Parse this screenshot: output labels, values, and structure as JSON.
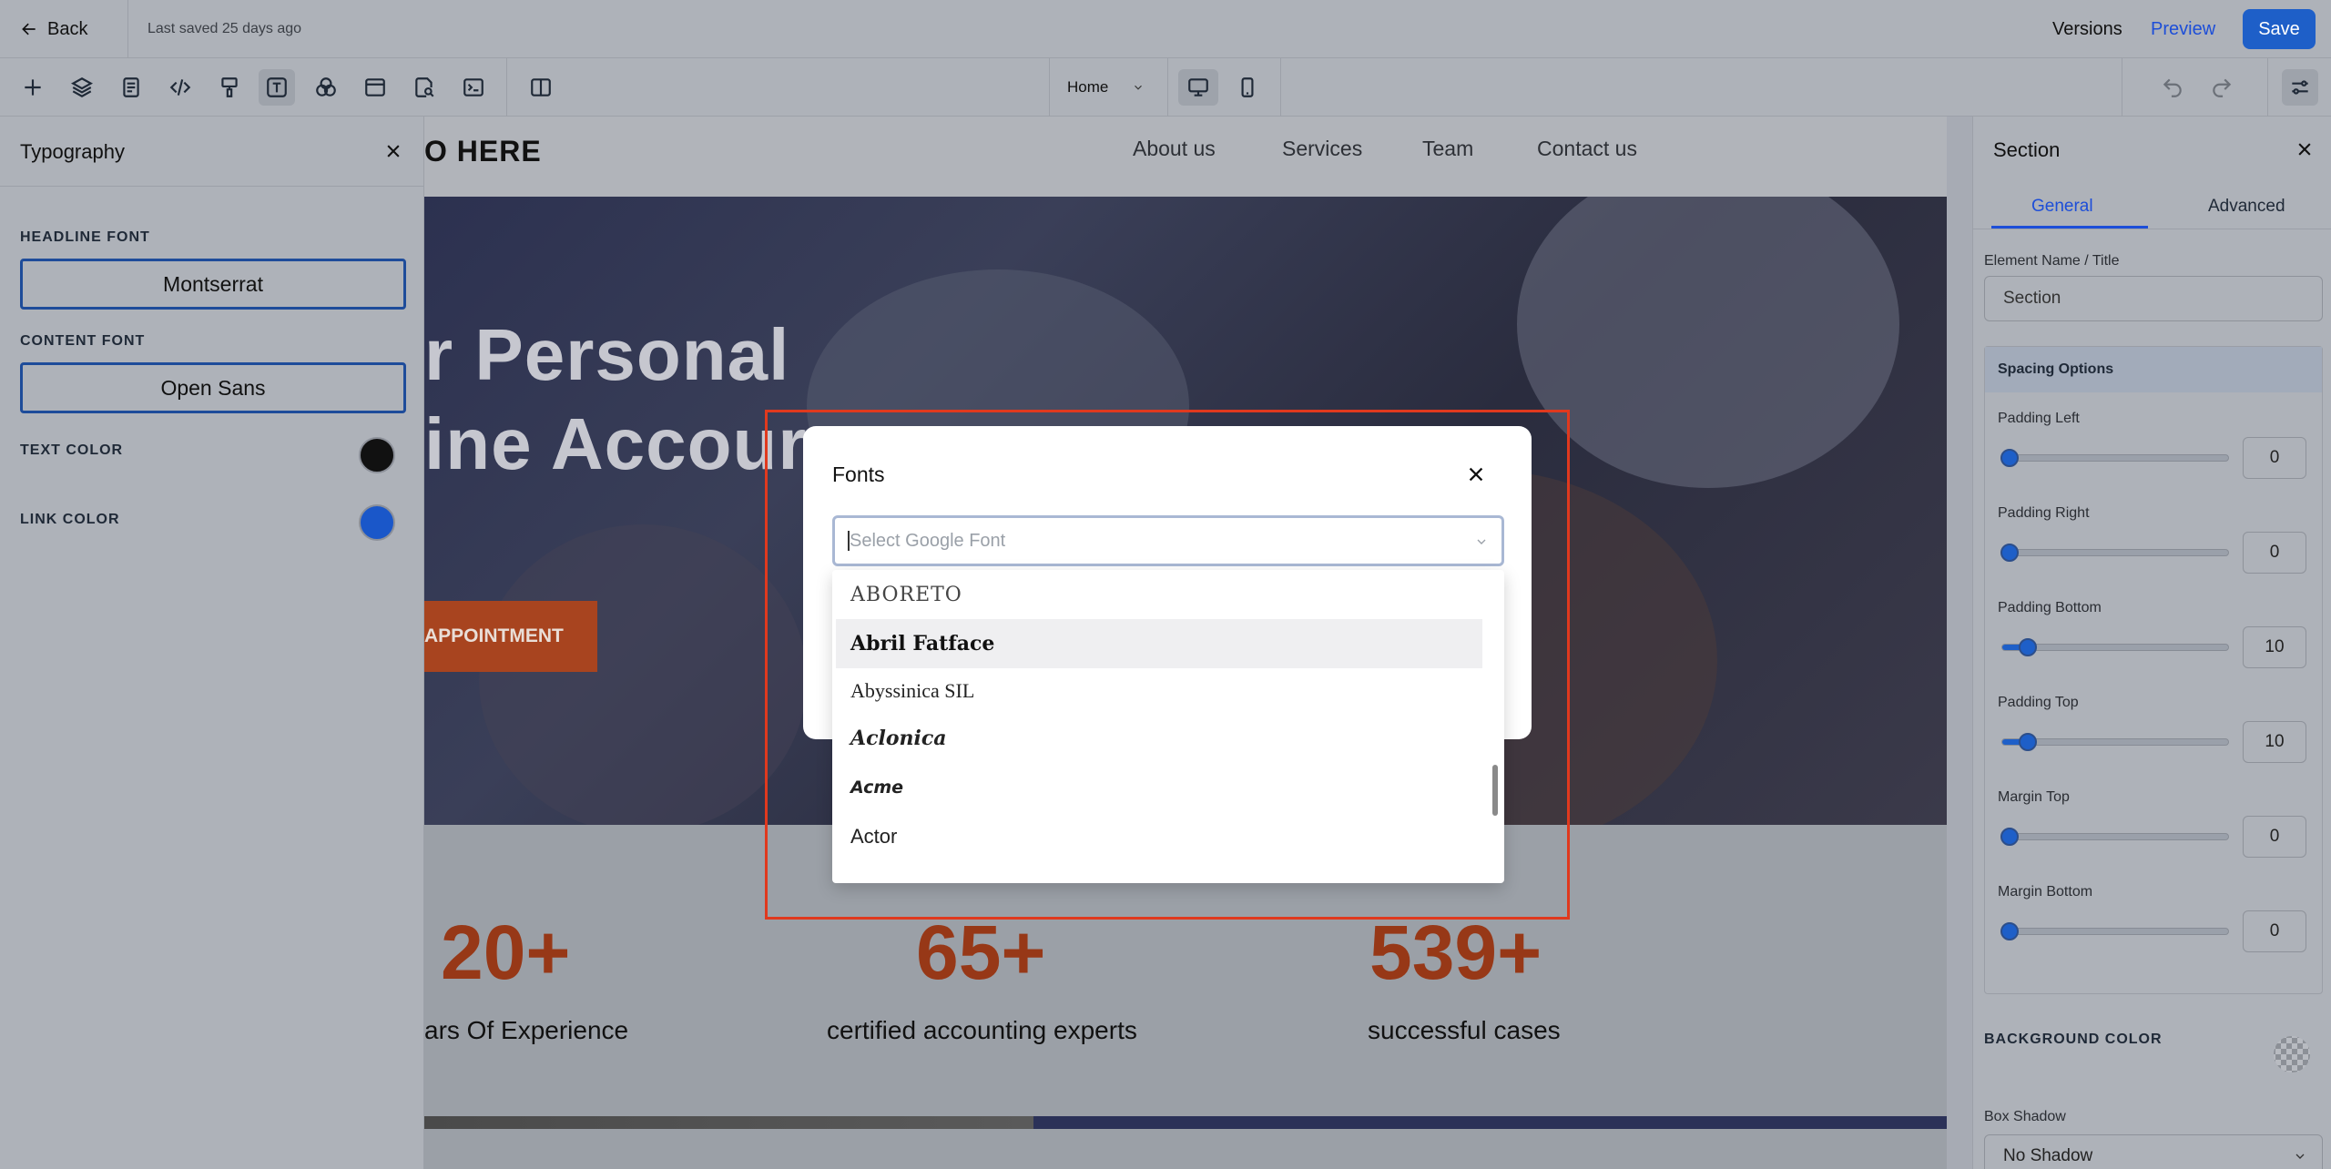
{
  "topbar": {
    "back_label": "Back",
    "last_saved": "Last saved 25 days ago",
    "versions_label": "Versions",
    "preview_label": "Preview",
    "save_label": "Save"
  },
  "toolbar": {
    "tools": [
      "add-icon",
      "layers-icon",
      "page-icon",
      "code-icon",
      "paint-icon",
      "typography-icon",
      "color-blend-icon",
      "window-icon",
      "search-page-icon",
      "terminal-icon",
      "split-view-icon"
    ],
    "active_tool": "typography-icon",
    "page_select": "Home",
    "devices": [
      "desktop-icon",
      "mobile-icon"
    ],
    "active_device": "desktop-icon"
  },
  "typography_panel": {
    "title": "Typography",
    "headline_font_label": "HEADLINE FONT",
    "headline_font_value": "Montserrat",
    "content_font_label": "CONTENT FONT",
    "content_font_value": "Open Sans",
    "text_color_label": "TEXT COLOR",
    "text_color": "#111111",
    "link_color_label": "LINK COLOR",
    "link_color": "#1a57c9"
  },
  "site": {
    "logo": "O HERE",
    "nav": [
      "About us",
      "Services",
      "Team",
      "Contact us"
    ],
    "hero_line1": "r Personal",
    "hero_line2": "ine Accour",
    "cta": "APPOINTMENT",
    "stats": [
      {
        "number": "20+",
        "label": "ars Of Experience"
      },
      {
        "number": "65+",
        "label": "certified accounting experts"
      },
      {
        "number": "539+",
        "label": "successful cases"
      }
    ]
  },
  "fonts_modal": {
    "title": "Fonts",
    "placeholder": "Select Google Font",
    "options": [
      "ABORETO",
      "Abril Fatface",
      "Abyssinica SIL",
      "Aclonica",
      "Acme",
      "Actor"
    ],
    "hovered_option": "Abril Fatface"
  },
  "section_panel": {
    "title": "Section",
    "tabs": [
      "General",
      "Advanced"
    ],
    "active_tab": "General",
    "element_name_label": "Element Name / Title",
    "element_name_value": "Section",
    "spacing_title": "Spacing Options",
    "spacing": [
      {
        "label": "Padding Left",
        "value": "0"
      },
      {
        "label": "Padding Right",
        "value": "0"
      },
      {
        "label": "Padding Bottom",
        "value": "10"
      },
      {
        "label": "Padding Top",
        "value": "10"
      },
      {
        "label": "Margin Top",
        "value": "0"
      },
      {
        "label": "Margin Bottom",
        "value": "0"
      }
    ],
    "background_color_label": "BACKGROUND COLOR",
    "box_shadow_label": "Box Shadow",
    "box_shadow_value": "No Shadow"
  },
  "colors": {
    "accent": "#1e5fc8",
    "highlight": "#e0391e",
    "stat_color": "#973817"
  }
}
